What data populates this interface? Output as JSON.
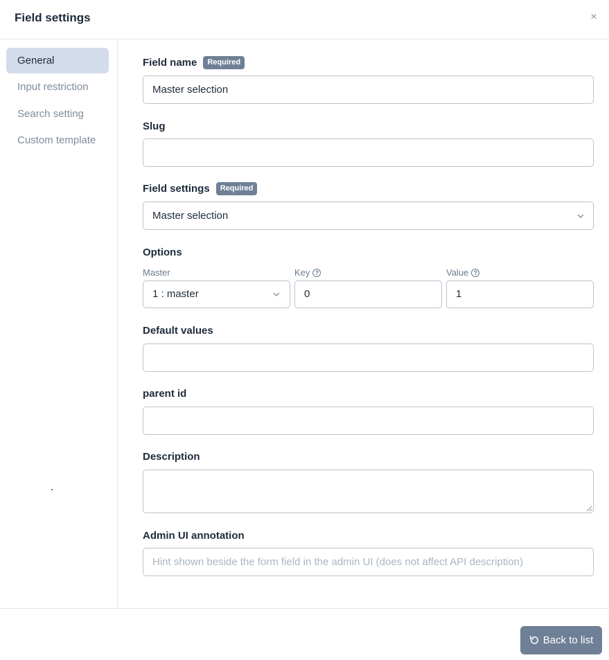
{
  "header": {
    "title": "Field settings",
    "close_glyph": "×"
  },
  "sidebar": {
    "items": [
      {
        "label": "General"
      },
      {
        "label": "Input restriction"
      },
      {
        "label": "Search setting"
      },
      {
        "label": "Custom template"
      }
    ]
  },
  "form": {
    "required_badge": "Required",
    "field_name": {
      "label": "Field name",
      "value": "Master selection"
    },
    "slug": {
      "label": "Slug",
      "value": ""
    },
    "field_settings": {
      "label": "Field settings",
      "value": "Master selection"
    },
    "options": {
      "label": "Options",
      "master_label": "Master",
      "master_value": "1 : master",
      "key_label": "Key",
      "key_value": "0",
      "value_label": "Value",
      "value_value": "1"
    },
    "default_values": {
      "label": "Default values",
      "value": ""
    },
    "parent_id": {
      "label": "parent id",
      "value": ""
    },
    "description": {
      "label": "Description",
      "value": ""
    },
    "admin_ui_annotation": {
      "label": "Admin UI annotation",
      "placeholder": "Hint shown beside the form field in the admin UI (does not affect API description)"
    }
  },
  "footer": {
    "back_label": "Back to list"
  },
  "icons": {
    "close": "close-icon",
    "chevron": "chevron-down-icon",
    "help": "help-circle-icon",
    "back": "rotate-ccw-icon"
  },
  "colors": {
    "active_nav": "#d3dcea",
    "badge": "#6f8096",
    "button": "#6f8096"
  }
}
